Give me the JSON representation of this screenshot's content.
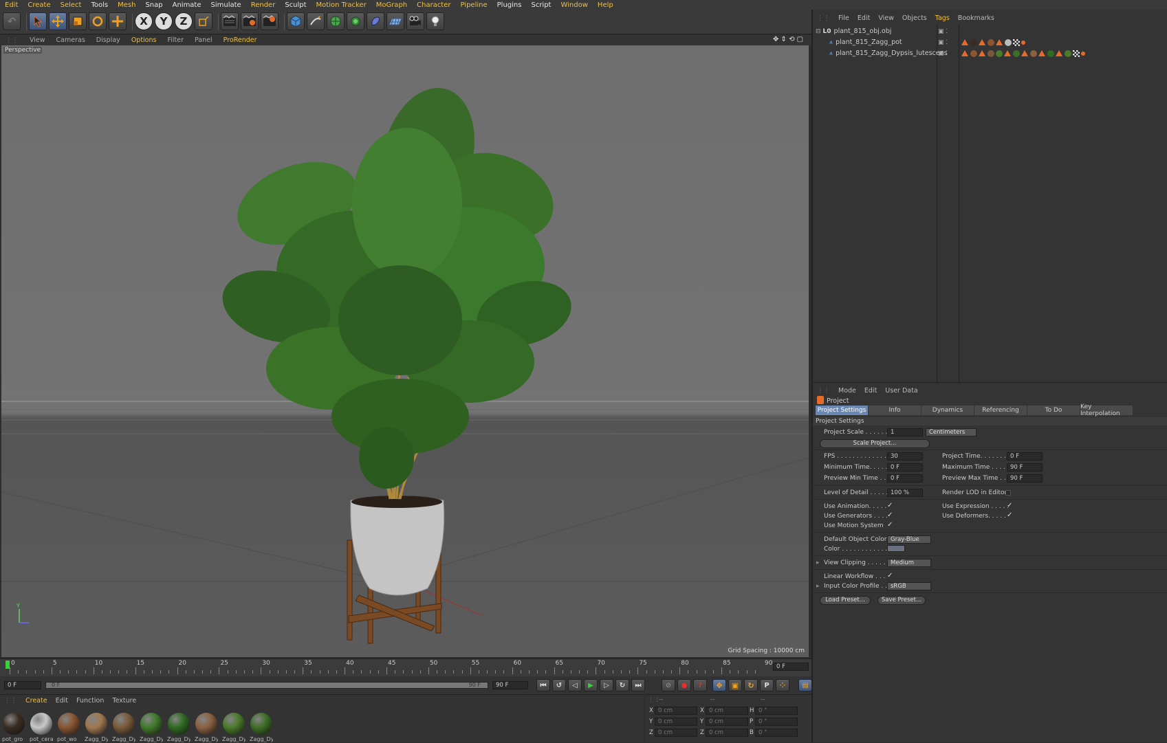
{
  "menu": [
    "Edit",
    "Create",
    "Select",
    "Tools",
    "Mesh",
    "Snap",
    "Animate",
    "Simulate",
    "Render",
    "Sculpt",
    "Motion Tracker",
    "MoGraph",
    "Character",
    "Pipeline",
    "Plugins",
    "Script",
    "Window",
    "Help"
  ],
  "toolbar": {
    "axis_x": "X",
    "axis_y": "Y",
    "axis_z": "Z"
  },
  "viewport_menu": [
    "View",
    "Cameras",
    "Display",
    "Options",
    "Filter",
    "Panel",
    "ProRender"
  ],
  "viewport": {
    "label": "Perspective",
    "grid_spacing": "Grid Spacing : 10000 cm"
  },
  "timeline": {
    "ticks": [
      "0",
      "5",
      "10",
      "15",
      "20",
      "25",
      "30",
      "35",
      "40",
      "45",
      "50",
      "55",
      "60",
      "65",
      "70",
      "75",
      "80",
      "85",
      "90"
    ],
    "current": "0 F",
    "start": "0 F",
    "range_start": "0 F",
    "range_end": "90 F",
    "end": "90 F"
  },
  "materials": {
    "menu": [
      "Create",
      "Edit",
      "Function",
      "Texture"
    ],
    "items": [
      {
        "name": "pot_gro",
        "color": "#3a2c22"
      },
      {
        "name": "pot_cera",
        "color": "#c8c8c8"
      },
      {
        "name": "pot_wo",
        "color": "#8a5530"
      },
      {
        "name": "Zagg_Dy",
        "color": "#a07850"
      },
      {
        "name": "Zagg_Dy",
        "color": "#7a5a3a"
      },
      {
        "name": "Zagg_Dy",
        "color": "#3f7a2a"
      },
      {
        "name": "Zagg_Dy",
        "color": "#2f6a22"
      },
      {
        "name": "Zagg_Dy",
        "color": "#8a6040"
      },
      {
        "name": "Zagg_Dy",
        "color": "#4a7a2a"
      },
      {
        "name": "Zagg_Dy",
        "color": "#3d6e25"
      }
    ]
  },
  "coords": {
    "header": [
      "--",
      "--",
      "--"
    ],
    "rows": [
      {
        "a": "X",
        "av": "0 cm",
        "b": "X",
        "bv": "0 cm",
        "c": "H",
        "cv": "0 °"
      },
      {
        "a": "Y",
        "av": "0 cm",
        "b": "Y",
        "bv": "0 cm",
        "c": "P",
        "cv": "0 °"
      },
      {
        "a": "Z",
        "av": "0 cm",
        "b": "Z",
        "bv": "0 cm",
        "c": "B",
        "cv": "0 °"
      }
    ]
  },
  "objects": {
    "menu": [
      "File",
      "Edit",
      "View",
      "Objects",
      "Tags",
      "Bookmarks"
    ],
    "items": [
      {
        "name": "plant_815_obj.obj"
      },
      {
        "name": "plant_815_Zagg_pot"
      },
      {
        "name": "plant_815_Zagg_Dypsis_lutescens"
      }
    ]
  },
  "attributes": {
    "menu": [
      "Mode",
      "Edit",
      "User Data"
    ],
    "title": "Project",
    "tabs": [
      "Project Settings",
      "Info",
      "Dynamics",
      "Referencing",
      "To Do",
      "Key Interpolation"
    ],
    "section": "Project Settings",
    "project_scale_label": "Project Scale . . . . . .",
    "project_scale": "1",
    "scale_unit": "Centimeters",
    "scale_project_btn": "Scale Project...",
    "fps_label": "FPS . . . . . . . . . . . . . .",
    "fps": "30",
    "min_time_label": "Minimum Time. . . . .",
    "min_time": "0 F",
    "preview_min_label": "Preview Min Time . .",
    "preview_min": "0 F",
    "project_time_label": "Project Time. . . . . . . .",
    "project_time": "0 F",
    "max_time_label": "Maximum Time . . . . .",
    "max_time": "90 F",
    "preview_max_label": "Preview Max Time . . .",
    "preview_max": "90 F",
    "lod_label": "Level of Detail . . . . .",
    "lod": "100 %",
    "render_lod_label": "Render LOD in Editor",
    "use_anim_label": "Use Animation. . . . .",
    "use_gen_label": "Use Generators . . . .",
    "use_motion_label": "Use Motion System",
    "use_expr_label": "Use Expression . . . . .",
    "use_deform_label": "Use Deformers. . . . .",
    "default_color_label": "Default Object Color",
    "default_color": "Gray-Blue",
    "color_label": "Color . . . . . . . . . . . .",
    "view_clip_label": "View Clipping . . . . .",
    "view_clip": "Medium",
    "linear_label": "Linear Workflow . . .",
    "input_profile_label": "Input Color Profile . .",
    "input_profile": "sRGB",
    "load_preset": "Load Preset...",
    "save_preset": "Save Preset..."
  }
}
